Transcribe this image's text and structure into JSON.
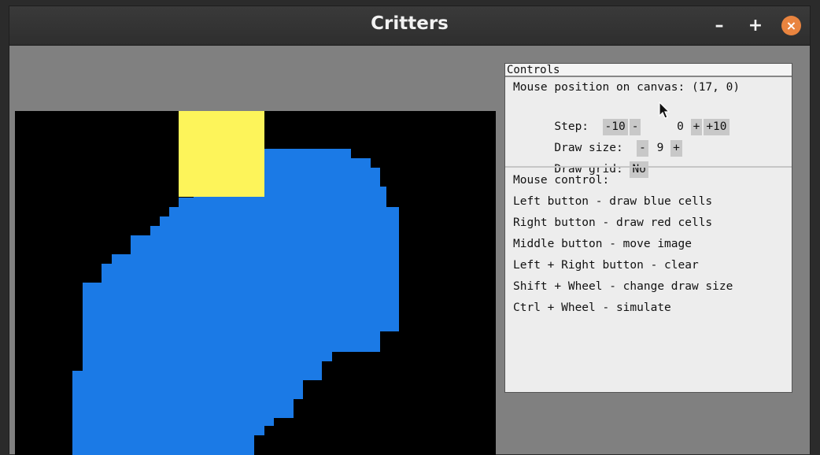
{
  "window": {
    "title": "Critters",
    "minimize_label": "–",
    "maximize_label": "+",
    "close_label": "×"
  },
  "canvas": {
    "colors": {
      "background": "#000000",
      "blue_cells": "#1b7ae6",
      "yellow_cell": "#fdf45a"
    }
  },
  "controls": {
    "title": "Controls",
    "mouse_position_text": "Mouse position on canvas: (17, 0)",
    "step": {
      "label": "Step:",
      "minus10": "-10",
      "minus1": "-",
      "value": "0",
      "plus1": "+",
      "plus10": "+10"
    },
    "draw_size": {
      "label": "Draw size:",
      "minus": "-",
      "value": "9",
      "plus": "+"
    },
    "draw_grid": {
      "label": "Draw grid:",
      "value": "No"
    },
    "mouse_control_heading": "Mouse control:",
    "help_lines": [
      "Left button - draw blue cells",
      "Right button - draw red cells",
      "Middle button - move image",
      "Left + Right button - clear",
      "Shift + Wheel - change draw size",
      "Ctrl + Wheel - simulate"
    ]
  }
}
